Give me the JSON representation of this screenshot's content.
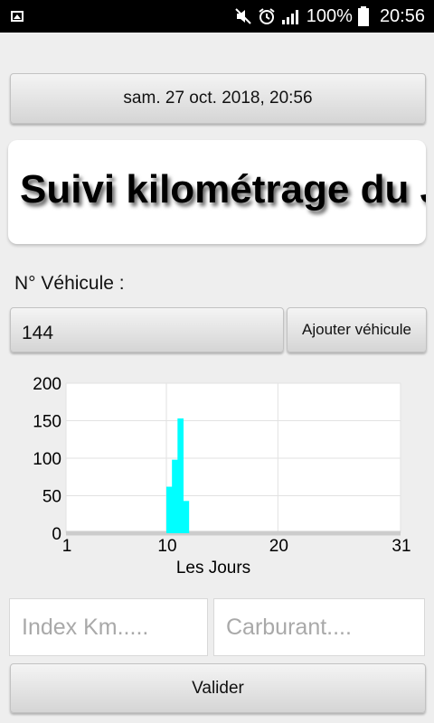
{
  "status_bar": {
    "battery_text": "100%",
    "time": "20:56",
    "icons": [
      "gallery-icon",
      "mute-icon",
      "alarm-icon",
      "signal-icon",
      "battery-icon"
    ]
  },
  "date_button": {
    "label": "sam. 27 oct. 2018, 20:56"
  },
  "title": "Suivi kilométrage du J",
  "vehicle": {
    "label": "N° Véhicule :",
    "value": "144",
    "add_button": "Ajouter véhicule"
  },
  "chart_data": {
    "type": "bar",
    "xlabel": "Les Jours",
    "ylabel": "",
    "xlim": [
      1,
      31
    ],
    "ylim": [
      0,
      200
    ],
    "x_ticks": [
      "1",
      "10",
      "20",
      "31"
    ],
    "y_ticks": [
      "0",
      "50",
      "100",
      "150",
      "200"
    ],
    "grid": true,
    "bar_color": "#00ffff",
    "x": [
      9.5,
      10,
      10.5,
      11,
      11.5,
      12
    ],
    "values": [
      0,
      62,
      98,
      153,
      43,
      0
    ]
  },
  "inputs": {
    "km_placeholder": "Index Km.....",
    "fuel_placeholder": "Carburant...."
  },
  "valider_button": "Valider"
}
